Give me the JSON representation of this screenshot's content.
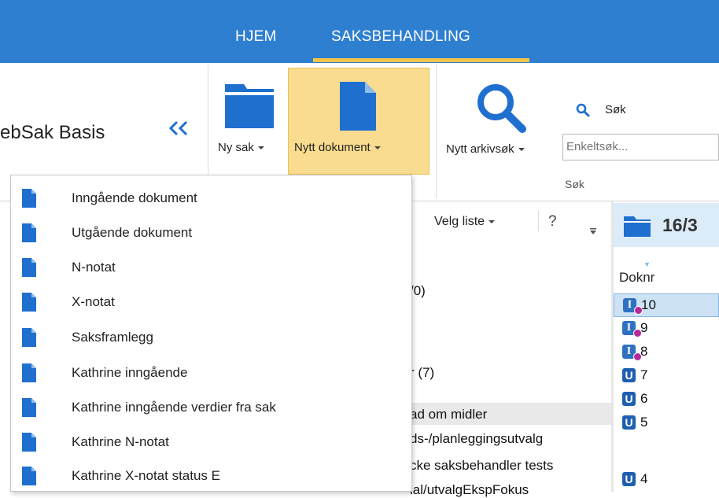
{
  "nav": {
    "tabs": [
      {
        "label": "HJEM"
      },
      {
        "label": "SAKSBEHANDLING"
      }
    ]
  },
  "app": {
    "title": "ebSak Basis",
    "collapse_glyph": "«"
  },
  "ribbon": {
    "ny_sak": "Ny sak",
    "nytt_dokument": "Nytt dokument",
    "nytt_arkivsok": "Nytt arkivsøk",
    "sok_label": "Søk",
    "sok_placeholder": "Enkeltsøk...",
    "group_label": "Søk"
  },
  "list_toolbar": {
    "velg_liste": "Velg liste",
    "help": "?"
  },
  "mid_texts": [
    "/0)",
    "r (7)",
    "ad om midler",
    "ds-/planleggingsutvalg",
    "cke saksbehandler tests",
    "lal/utvalgEkspFokus"
  ],
  "case_panel": {
    "case_number": "16/3",
    "column_header": "Doknr"
  },
  "docs": [
    {
      "type": "I",
      "num": "10",
      "locked": true,
      "selected": true
    },
    {
      "type": "I",
      "num": "9",
      "locked": true
    },
    {
      "type": "I",
      "num": "8",
      "locked": true
    },
    {
      "type": "U",
      "num": "7"
    },
    {
      "type": "U",
      "num": "6"
    },
    {
      "type": "U",
      "num": "5"
    },
    {
      "type": "U",
      "num": "4"
    }
  ],
  "menu": {
    "items": [
      {
        "label": "Inngående dokument"
      },
      {
        "label": "Utgående dokument"
      },
      {
        "label": "N-notat"
      },
      {
        "label": "X-notat"
      },
      {
        "label": "Saksframlegg"
      },
      {
        "label": "Kathrine inngående"
      },
      {
        "label": "Kathrine inngående verdier fra sak"
      },
      {
        "label": "Kathrine N-notat"
      },
      {
        "label": "Kathrine X-notat status E"
      }
    ]
  },
  "colors": {
    "nav_blue": "#2f7fd1",
    "accent": "#f5c54a",
    "icon_blue": "#1f6fcf",
    "highlight": "#f9dc8f"
  }
}
